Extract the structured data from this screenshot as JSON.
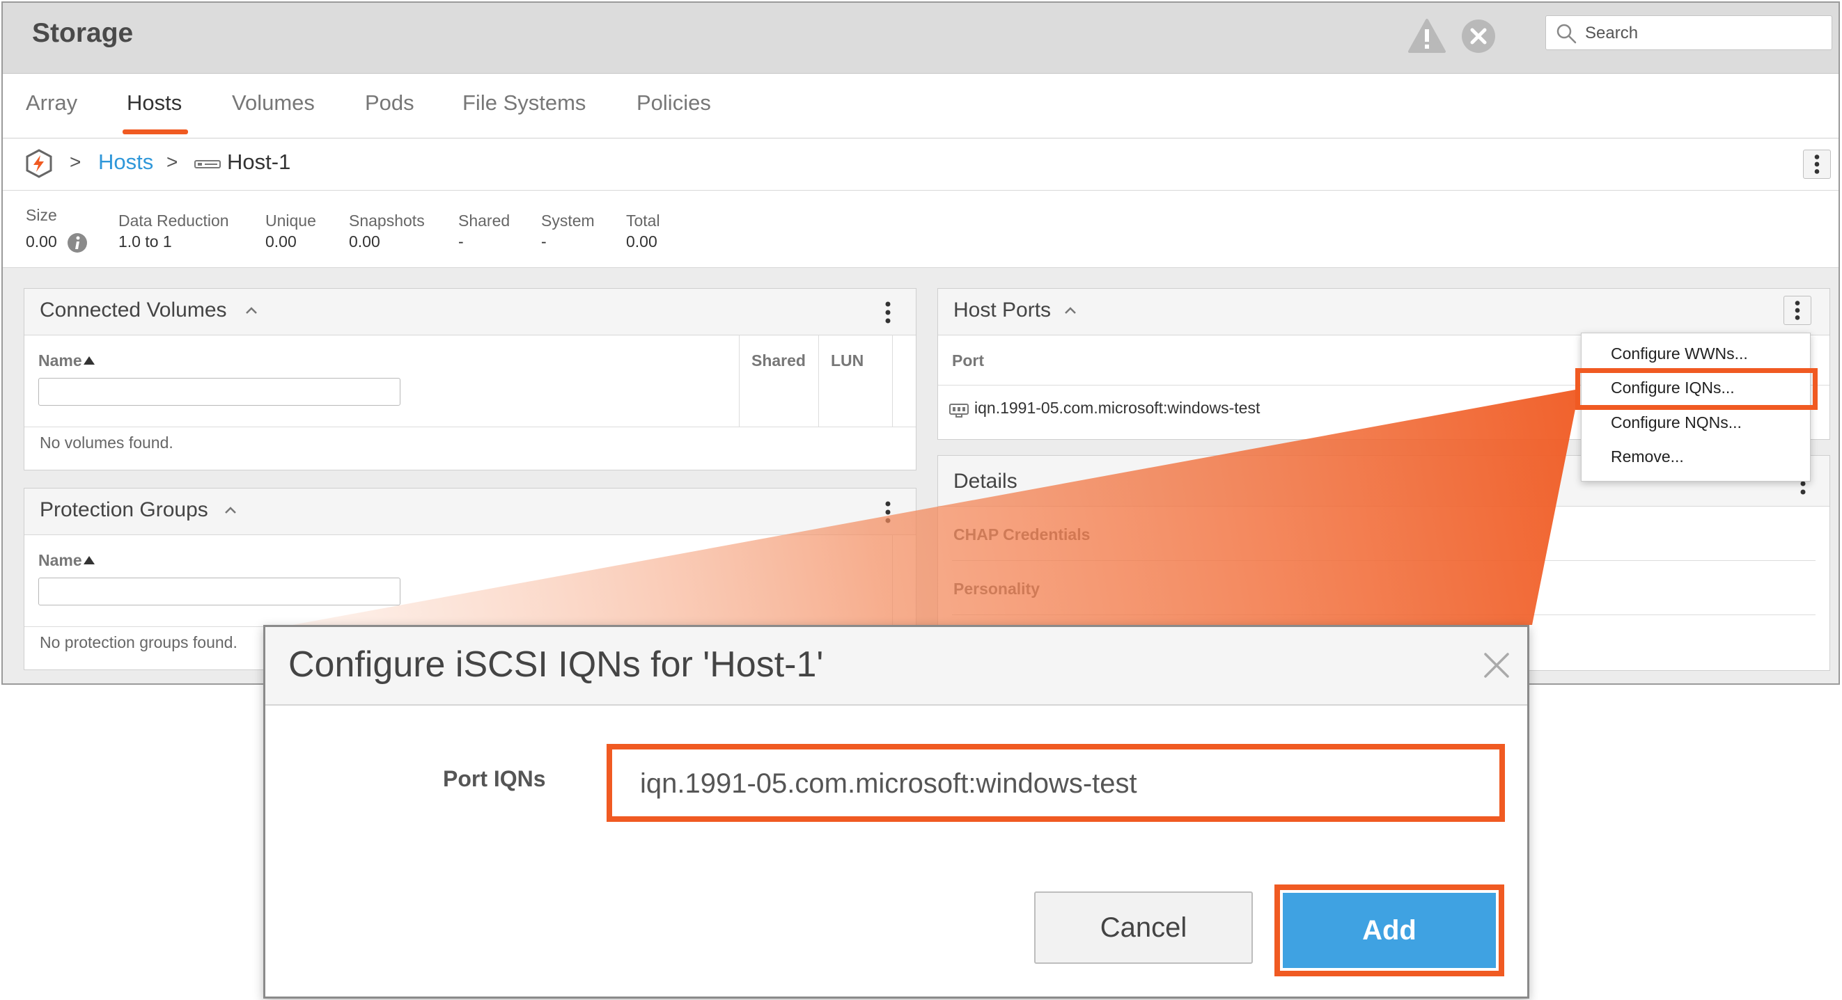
{
  "app": {
    "title": "Storage"
  },
  "search": {
    "placeholder": "Search",
    "icon": "search-icon"
  },
  "header_icons": {
    "alert": "alert-triangle-icon",
    "close": "close-circle-icon"
  },
  "tabs": [
    "Array",
    "Hosts",
    "Volumes",
    "Pods",
    "File Systems",
    "Policies"
  ],
  "active_tab": "Hosts",
  "breadcrumb": {
    "sep": ">",
    "hosts": "Hosts",
    "host": "Host-1"
  },
  "stats": {
    "labels": [
      "Size",
      "Data Reduction",
      "Unique",
      "Snapshots",
      "Shared",
      "System",
      "Total"
    ],
    "values": [
      "0.00",
      "1.0 to 1",
      "0.00",
      "0.00",
      "-",
      "-",
      "0.00"
    ]
  },
  "connected_volumes": {
    "title": "Connected Volumes",
    "columns": [
      "Name",
      "Shared",
      "LUN"
    ],
    "empty": "No volumes found."
  },
  "protection_groups": {
    "title": "Protection Groups",
    "columns": [
      "Name"
    ],
    "empty": "No protection groups found."
  },
  "host_ports": {
    "title": "Host Ports",
    "column": "Port",
    "port": "iqn.1991-05.com.microsoft:windows-test"
  },
  "details": {
    "title": "Details",
    "rows": [
      "CHAP Credentials",
      "Personality"
    ]
  },
  "port_menu": [
    "Configure WWNs...",
    "Configure IQNs...",
    "Configure NQNs...",
    "Remove..."
  ],
  "dialog": {
    "title": "Configure iSCSI IQNs for 'Host-1'",
    "field_label": "Port IQNs",
    "field_value": "iqn.1991-05.com.microsoft:windows-test",
    "cancel": "Cancel",
    "add": "Add"
  },
  "colors": {
    "accent": "#f05a22",
    "link": "#2f97d9",
    "primary_button": "#3fa2e2"
  }
}
